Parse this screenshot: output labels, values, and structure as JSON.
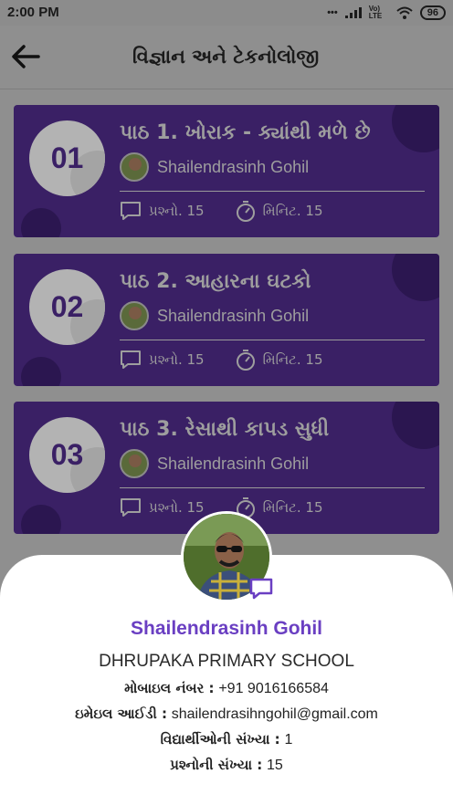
{
  "status_bar": {
    "time": "2:00 PM",
    "signal_text": "Vo) LTE",
    "battery": "96"
  },
  "header": {
    "title": "વિજ્ઞાન અને ટેકનોલોજી"
  },
  "lessons": [
    {
      "number": "01",
      "title": "પાઠ 1. ખોરાક - ક્યાંથી મળે છે",
      "author": "Shailendrasinh Gohil",
      "questions": "પ્રશ્નો. 15",
      "minutes": "મિનિટ. 15"
    },
    {
      "number": "02",
      "title": "પાઠ 2. આહારના ઘટકો",
      "author": "Shailendrasinh Gohil",
      "questions": "પ્રશ્નો. 15",
      "minutes": "મિનિટ. 15"
    },
    {
      "number": "03",
      "title": "પાઠ 3. રેસાથી કાપડ સુધી",
      "author": "Shailendrasinh Gohil",
      "questions": "પ્રશ્નો. 15",
      "minutes": "મિનિટ. 15"
    }
  ],
  "profile": {
    "name": "Shailendrasinh Gohil",
    "school": "DHRUPAKA PRIMARY SCHOOL",
    "mobile_label": "મોબાઇલ નંબર :",
    "mobile_value": "+91 9016166584",
    "email_label": "ઇમેઇલ આઈડી :",
    "email_value": "shailendrasihngohil@gmail.com",
    "students_label": "વિદ્યાર્થીઓની સંખ્યા :",
    "students_value": "1",
    "questions_label": "પ્રશ્નોની સંખ્યા :",
    "questions_value": "15"
  },
  "colors": {
    "accent": "#6a3fc2",
    "card": "#3a2065",
    "overlay": "#8f8f8f"
  }
}
